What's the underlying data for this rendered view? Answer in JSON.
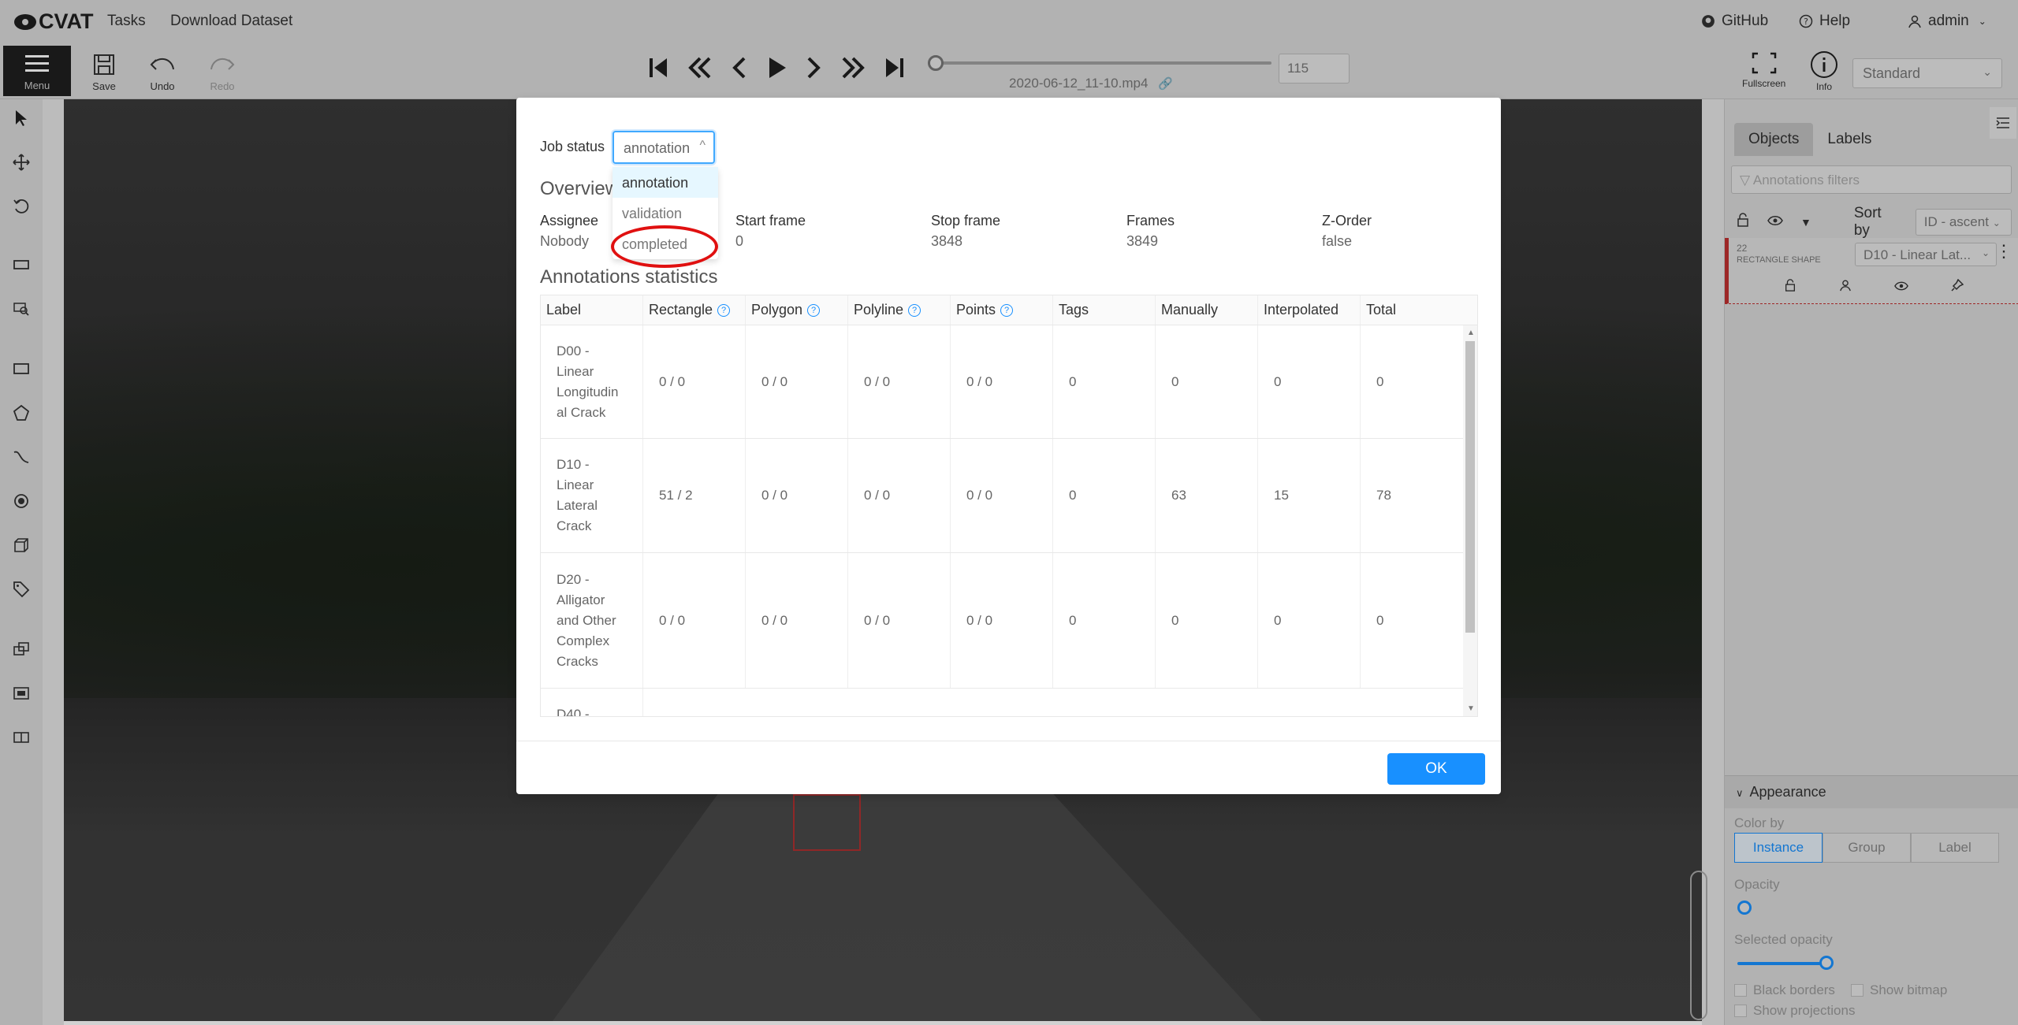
{
  "header": {
    "logo": "CVAT",
    "nav": [
      "Tasks",
      "Download Dataset"
    ],
    "github": "GitHub",
    "help": "Help",
    "user": "admin"
  },
  "toolbar": {
    "menu_label": "Menu",
    "save_label": "Save",
    "undo_label": "Undo",
    "redo_label": "Redo",
    "filename": "2020-06-12_11-10.mp4",
    "frame_number": "115",
    "fullscreen_label": "Fullscreen",
    "info_label": "Info",
    "workspace": "Standard"
  },
  "right_panel": {
    "tabs": [
      "Objects",
      "Labels"
    ],
    "filter_placeholder": "Annotations filters",
    "sort_label": "Sort by",
    "sort_value": "ID - ascent",
    "object": {
      "id": "22",
      "type": "RECTANGLE SHAPE",
      "label": "D10 - Linear Lat..."
    },
    "appearance": {
      "title": "Appearance",
      "color_by_label": "Color by",
      "color_by_options": [
        "Instance",
        "Group",
        "Label"
      ],
      "opacity_label": "Opacity",
      "selected_opacity_label": "Selected opacity",
      "black_borders": "Black borders",
      "show_bitmap": "Show bitmap",
      "show_projections": "Show projections"
    }
  },
  "modal": {
    "job_status_label": "Job status",
    "job_status_value": "annotation",
    "dropdown_options": [
      "annotation",
      "validation",
      "completed"
    ],
    "overview_title": "Overview",
    "assignee_label": "Assignee",
    "assignee_value": "Nobody",
    "start_frame_label": "Start frame",
    "start_frame_value": "0",
    "stop_frame_label": "Stop frame",
    "stop_frame_value": "3848",
    "frames_label": "Frames",
    "frames_value": "3849",
    "zorder_label": "Z-Order",
    "zorder_value": "false",
    "stats_title": "Annotations statistics",
    "columns": [
      "Label",
      "Rectangle",
      "Polygon",
      "Polyline",
      "Points",
      "Tags",
      "Manually",
      "Interpolated",
      "Total"
    ],
    "rows": [
      {
        "label": "D00 - Linear Longitudin al Crack",
        "cells": [
          "0 / 0",
          "0 / 0",
          "0 / 0",
          "0 / 0",
          "0",
          "0",
          "0",
          "0"
        ]
      },
      {
        "label": "D10 - Linear Lateral Crack",
        "cells": [
          "51 / 2",
          "0 / 0",
          "0 / 0",
          "0 / 0",
          "0",
          "63",
          "15",
          "78"
        ]
      },
      {
        "label": "D20 - Alligator and Other Complex Cracks",
        "cells": [
          "0 / 0",
          "0 / 0",
          "0 / 0",
          "0 / 0",
          "0",
          "0",
          "0",
          "0"
        ]
      },
      {
        "label": "D40 -",
        "cells": [
          "",
          "",
          "",
          "",
          "",
          "",
          "",
          ""
        ]
      }
    ],
    "ok_label": "OK"
  },
  "colors": {
    "accent": "#1890ff",
    "annotation_mark": "#e01010"
  }
}
